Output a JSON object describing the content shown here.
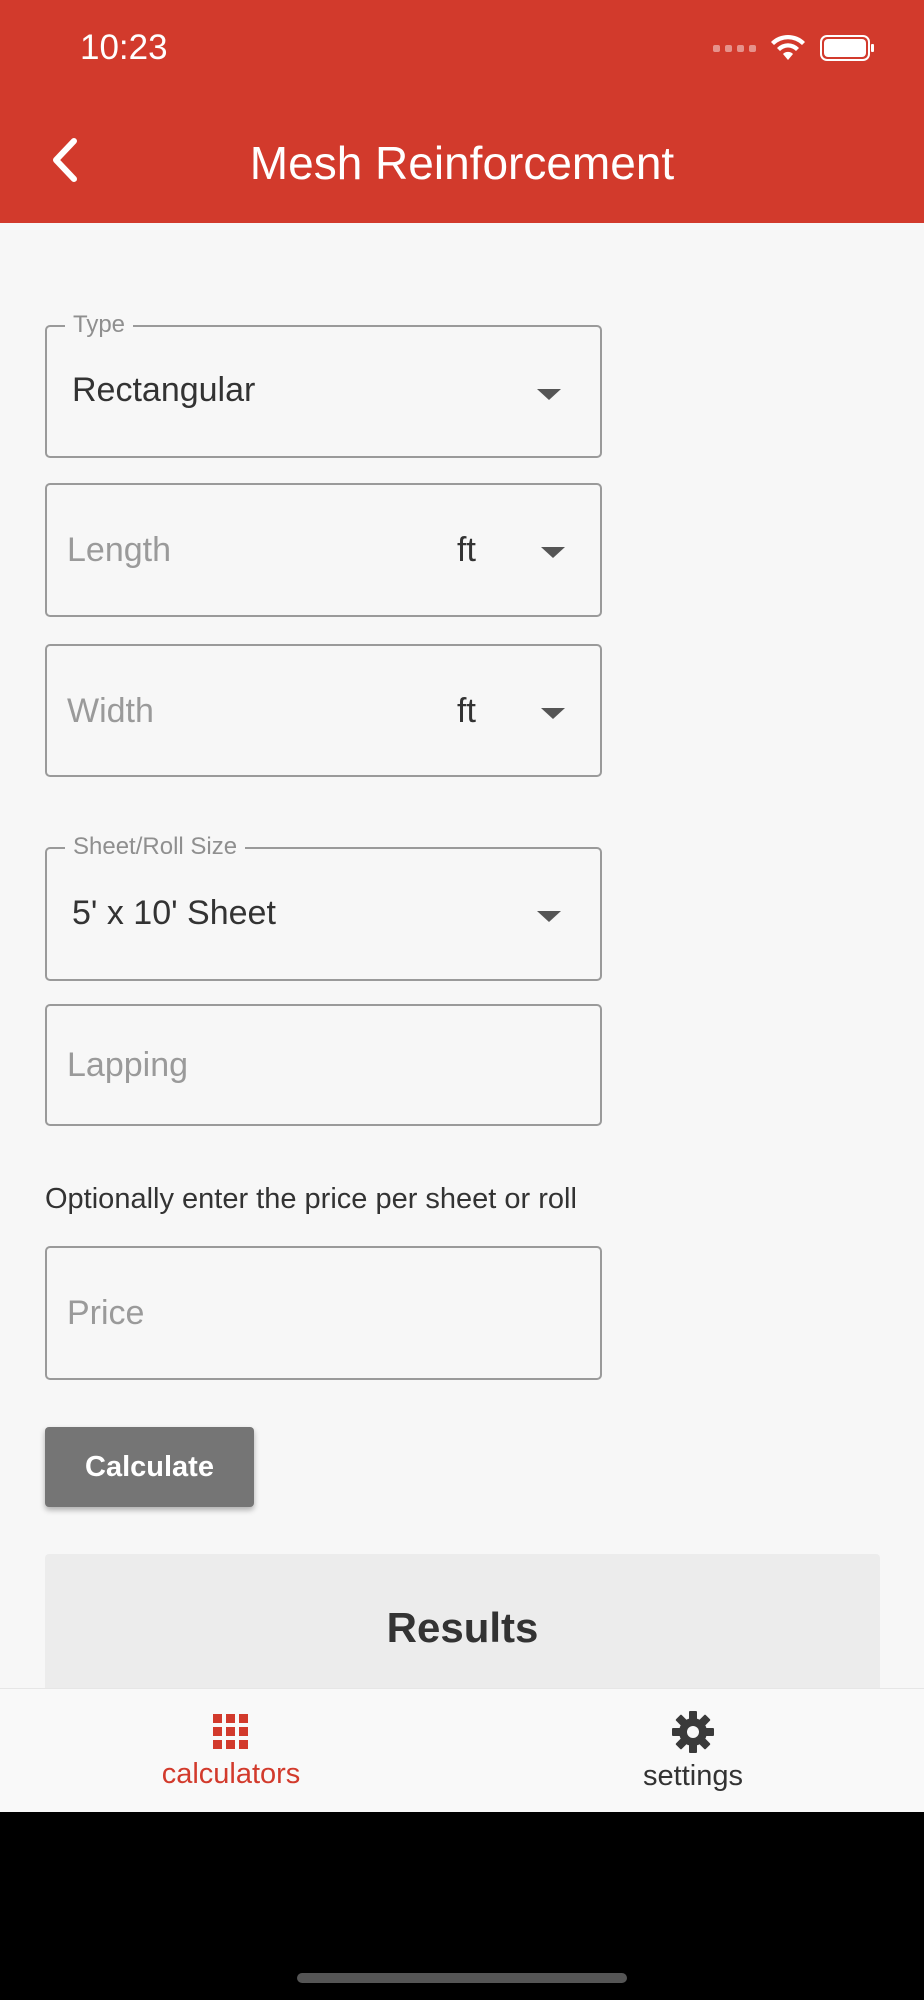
{
  "status_bar": {
    "time": "10:23"
  },
  "header": {
    "title": "Mesh Reinforcement"
  },
  "form": {
    "type": {
      "label": "Type",
      "value": "Rectangular"
    },
    "length": {
      "placeholder": "Length",
      "unit": "ft"
    },
    "width": {
      "placeholder": "Width",
      "unit": "ft"
    },
    "sheet_size": {
      "label": "Sheet/Roll Size",
      "value": "5' x 10' Sheet"
    },
    "lapping": {
      "placeholder": "Lapping"
    },
    "price_hint": "Optionally enter the price per sheet or roll",
    "price": {
      "placeholder": "Price"
    },
    "calculate_label": "Calculate"
  },
  "results": {
    "title": "Results"
  },
  "bottom_nav": {
    "items": [
      {
        "label": "calculators",
        "icon": "grid-icon",
        "active": true
      },
      {
        "label": "settings",
        "icon": "gear-icon",
        "active": false
      }
    ]
  },
  "colors": {
    "accent": "#d23a2c",
    "button": "#757575"
  }
}
